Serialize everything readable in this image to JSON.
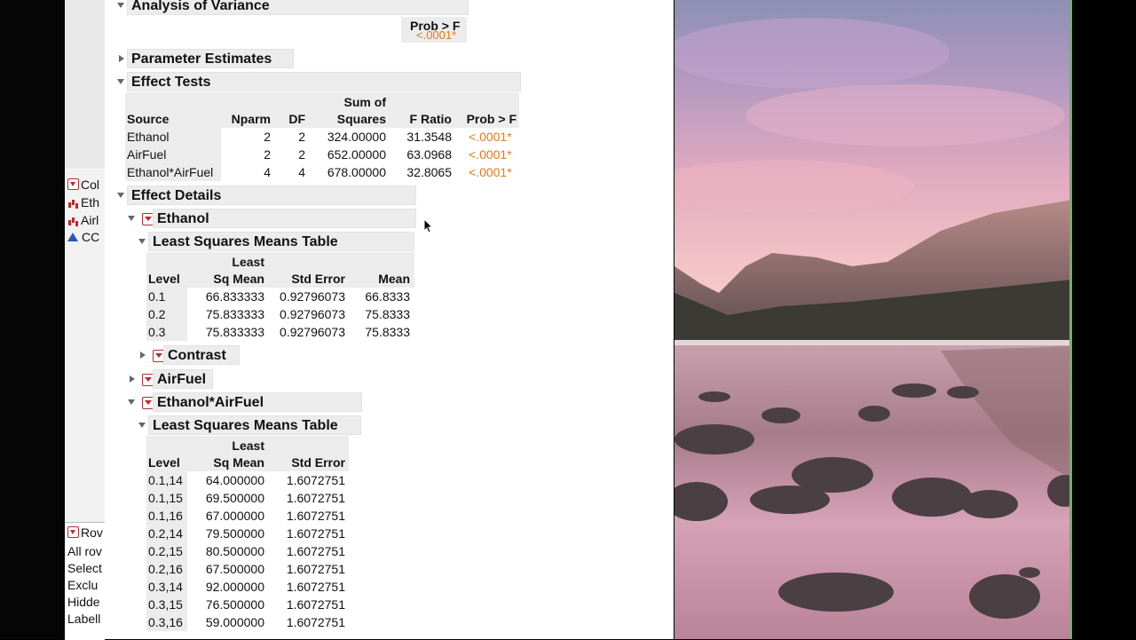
{
  "left_panel": {
    "items_top": [
      {
        "label": "Col",
        "icon": "menu-triangle-icon"
      },
      {
        "label": "Eth",
        "icon": "bar-chart-icon"
      },
      {
        "label": "Airl",
        "icon": "bar-chart-icon"
      },
      {
        "label": "CC",
        "icon": "blue-triangle-icon"
      }
    ],
    "rows_label": "Rov",
    "row_states": [
      "All rov",
      "Select",
      "Exclu",
      "Hidde",
      "Labell"
    ]
  },
  "report": {
    "anova": {
      "title": "Analysis of Variance",
      "prob_header": "Prob > F",
      "prob_value": "<.0001*"
    },
    "param_estimates": {
      "title": "Parameter Estimates"
    },
    "effect_tests": {
      "title": "Effect Tests",
      "headers": {
        "source": "Source",
        "nparm": "Nparm",
        "df": "DF",
        "ss_top": "Sum of",
        "ss": "Squares",
        "f": "F Ratio",
        "p": "Prob > F"
      },
      "rows": [
        {
          "source": "Ethanol",
          "nparm": "2",
          "df": "2",
          "ss": "324.00000",
          "f": "31.3548",
          "p": "<.0001*"
        },
        {
          "source": "AirFuel",
          "nparm": "2",
          "df": "2",
          "ss": "652.00000",
          "f": "63.0968",
          "p": "<.0001*"
        },
        {
          "source": "Ethanol*AirFuel",
          "nparm": "4",
          "df": "4",
          "ss": "678.00000",
          "f": "32.8065",
          "p": "<.0001*"
        }
      ]
    },
    "effect_details": {
      "title": "Effect Details",
      "ethanol": {
        "title": "Ethanol",
        "lsm_title": "Least Squares Means Table",
        "headers": {
          "level": "Level",
          "lsm_top": "Least",
          "lsm": "Sq Mean",
          "se": "Std Error",
          "mean": "Mean"
        },
        "rows": [
          {
            "level": "0.1",
            "lsm": "66.833333",
            "se": "0.92796073",
            "mean": "66.8333"
          },
          {
            "level": "0.2",
            "lsm": "75.833333",
            "se": "0.92796073",
            "mean": "75.8333"
          },
          {
            "level": "0.3",
            "lsm": "75.833333",
            "se": "0.92796073",
            "mean": "75.8333"
          }
        ],
        "contrast": "Contrast"
      },
      "airfuel": {
        "title": "AirFuel"
      },
      "interaction": {
        "title": "Ethanol*AirFuel",
        "lsm_title": "Least Squares Means Table",
        "headers": {
          "level": "Level",
          "lsm_top": "Least",
          "lsm": "Sq Mean",
          "se": "Std Error"
        },
        "rows": [
          {
            "level": "0.1,14",
            "lsm": "64.000000",
            "se": "1.6072751"
          },
          {
            "level": "0.1,15",
            "lsm": "69.500000",
            "se": "1.6072751"
          },
          {
            "level": "0.1,16",
            "lsm": "67.000000",
            "se": "1.6072751"
          },
          {
            "level": "0.2,14",
            "lsm": "79.500000",
            "se": "1.6072751"
          },
          {
            "level": "0.2,15",
            "lsm": "80.500000",
            "se": "1.6072751"
          },
          {
            "level": "0.2,16",
            "lsm": "67.500000",
            "se": "1.6072751"
          },
          {
            "level": "0.3,14",
            "lsm": "92.000000",
            "se": "1.6072751"
          },
          {
            "level": "0.3,15",
            "lsm": "76.500000",
            "se": "1.6072751"
          },
          {
            "level": "0.3,16",
            "lsm": "59.000000",
            "se": "1.6072751"
          }
        ]
      }
    }
  },
  "colors": {
    "orange_pvalue": "#e07a1a",
    "red_menu": "#c0262f",
    "outline_bg": "#ececec"
  }
}
